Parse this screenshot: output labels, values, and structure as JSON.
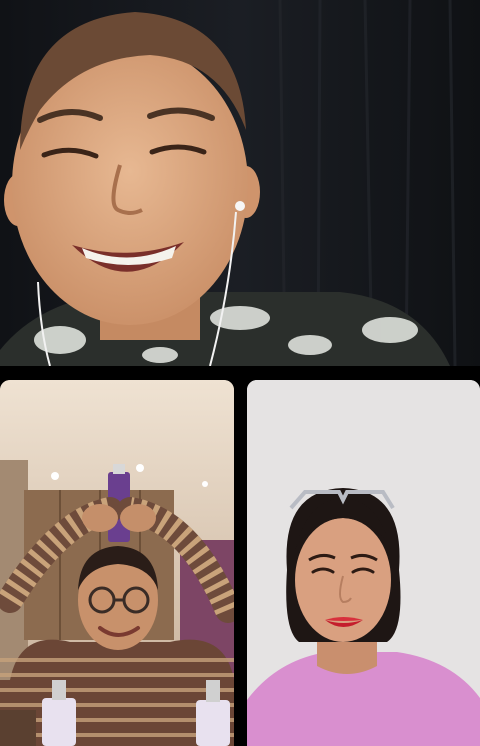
{
  "call": {
    "participants": [
      {
        "id": "participant-top",
        "video_on": true
      },
      {
        "id": "participant-bottom-left",
        "video_on": true
      },
      {
        "id": "participant-bottom-right",
        "video_on": true
      }
    ]
  },
  "colors": {
    "background": "#000000",
    "top_backdrop": "#14161a",
    "room_wall": "#cdb9a5",
    "plain_wall": "#e5e3e3",
    "pink_shirt": "#d98fcf"
  }
}
